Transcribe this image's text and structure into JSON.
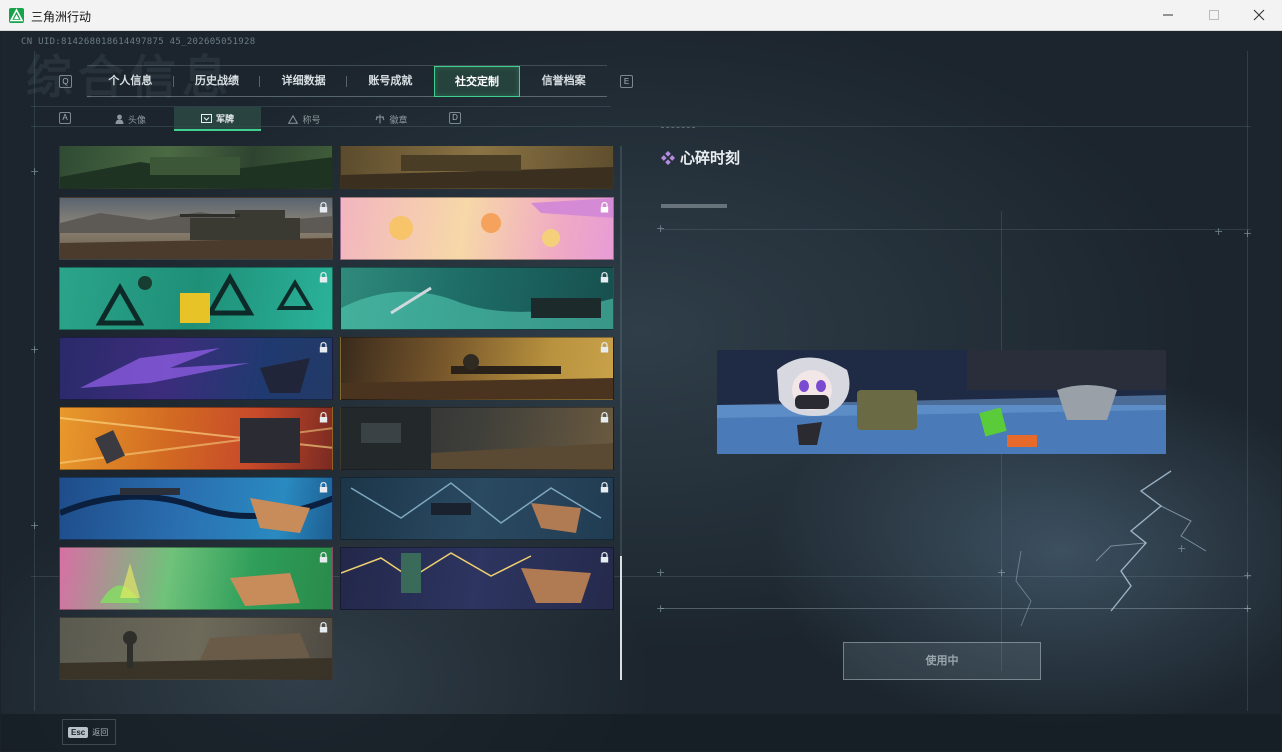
{
  "window": {
    "title": "三角洲行动"
  },
  "header": {
    "uid": "CN UID:814268018614497875 45_202605051928",
    "background_title": "综合信息"
  },
  "main_tabs": {
    "left_key": "Q",
    "right_key": "E",
    "items": [
      {
        "label": "个人信息"
      },
      {
        "label": "历史战绩"
      },
      {
        "label": "详细数据"
      },
      {
        "label": "账号成就"
      },
      {
        "label": "社交定制",
        "active": true
      },
      {
        "label": "信誉档案"
      }
    ]
  },
  "sub_tabs": {
    "left_key": "A",
    "right_key": "D",
    "items": [
      {
        "label": "头像",
        "icon": "person-icon"
      },
      {
        "label": "军牌",
        "icon": "badge-icon",
        "active": true
      },
      {
        "label": "称号",
        "icon": "triangle-icon"
      },
      {
        "label": "徽章",
        "icon": "medal-icon"
      }
    ]
  },
  "banners": [
    {
      "theme": "green-camo",
      "locked": false
    },
    {
      "theme": "brown-camo",
      "locked": false
    },
    {
      "theme": "desert-tank",
      "locked": true
    },
    {
      "theme": "pink-cartoon",
      "locked": true
    },
    {
      "theme": "teal-thumbs-up",
      "locked": true
    },
    {
      "theme": "teal-drone",
      "locked": true
    },
    {
      "theme": "purple-bird",
      "locked": true
    },
    {
      "theme": "desert-soldier",
      "locked": true
    },
    {
      "theme": "orange-robot",
      "locked": true
    },
    {
      "theme": "dark-ruins",
      "locked": true
    },
    {
      "theme": "blue-bird-hand",
      "locked": true
    },
    {
      "theme": "blue-spider-drone",
      "locked": true
    },
    {
      "theme": "green-plant-hand",
      "locked": true
    },
    {
      "theme": "navy-lightning-hand",
      "locked": true
    },
    {
      "theme": "ruined-village",
      "locked": true
    }
  ],
  "detail": {
    "title": "心碎时刻",
    "use_button": "使用中"
  },
  "footer": {
    "esc_key": "Esc",
    "esc_label": "返回"
  },
  "colors": {
    "accent": "#3fcf8e",
    "title_diamond": "#b58ce0"
  }
}
